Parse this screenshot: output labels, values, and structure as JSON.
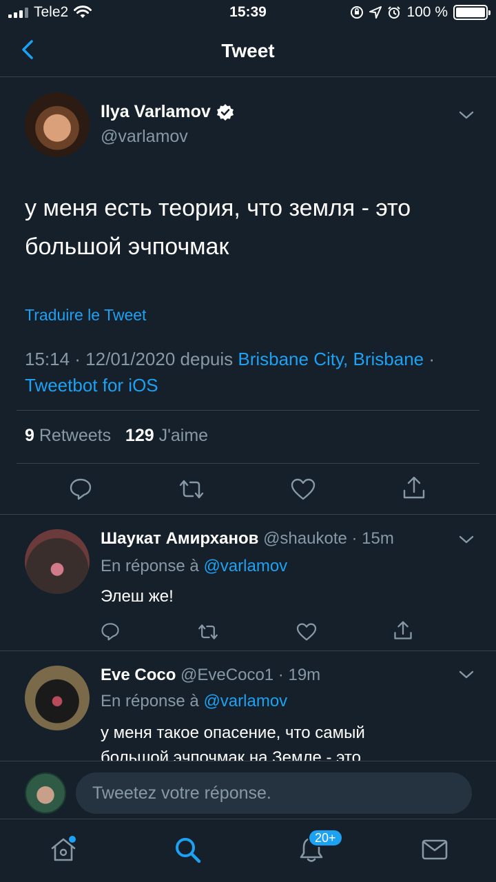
{
  "status_bar": {
    "carrier": "Tele2",
    "time": "15:39",
    "battery": "100 %"
  },
  "nav": {
    "title": "Tweet"
  },
  "tweet": {
    "author_name": "Ilya Varlamov",
    "author_handle": "@varlamov",
    "text": "у меня есть теория, что земля - это большой эчпочмак",
    "translate": "Traduire le Tweet",
    "meta_time": "15:14 · 12/01/2020 depuis ",
    "meta_location": "Brisbane City, Brisbane",
    "meta_sep": " · ",
    "meta_client": "Tweetbot for iOS",
    "retweets_count": "9",
    "retweets_label": "Retweets",
    "likes_count": "129",
    "likes_label": "J'aime"
  },
  "replies": [
    {
      "name": "Шаукат Амирханов",
      "handle": "@shaukote",
      "time": "15m",
      "reply_prefix": "En réponse à ",
      "reply_to": "@varlamov",
      "text": "Элеш же!"
    },
    {
      "name": "Eve Coco",
      "handle": "@EveCoco1",
      "time": "19m",
      "reply_prefix": "En réponse à ",
      "reply_to": "@varlamov",
      "text": "у меня такое опасение, что самый большой эчпочмак на Земле - это"
    }
  ],
  "compose": {
    "placeholder": "Tweetez votre réponse."
  },
  "tabbar": {
    "notifications_badge": "20+"
  },
  "colors": {
    "background": "#15202b",
    "accent": "#1da1f2",
    "muted": "#8899a6",
    "divider": "#38444d"
  }
}
